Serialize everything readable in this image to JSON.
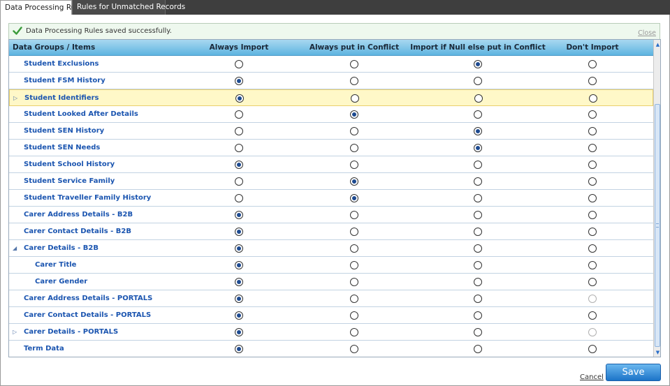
{
  "tabs": [
    {
      "label": "Data Processing Rules",
      "active": true
    },
    {
      "label": "Rules for Unmatched Records",
      "active": false
    }
  ],
  "message": {
    "text": "Data Processing Rules saved successfully.",
    "close_label": "Close"
  },
  "columns": [
    "Data Groups / Items",
    "Always Import",
    "Always put in Conflict",
    "Import if Null else put in Conflict",
    "Don't Import"
  ],
  "rows": [
    {
      "label": "Student Exclusions",
      "indent": 0,
      "expander": "",
      "selected": 2,
      "highlight": false,
      "dim_last": false
    },
    {
      "label": "Student FSM History",
      "indent": 0,
      "expander": "",
      "selected": 0,
      "highlight": false,
      "dim_last": false
    },
    {
      "label": "Student Identifiers",
      "indent": 0,
      "expander": "▷",
      "selected": 0,
      "highlight": true,
      "dim_last": false
    },
    {
      "label": "Student Looked After Details",
      "indent": 0,
      "expander": "",
      "selected": 1,
      "highlight": false,
      "dim_last": false
    },
    {
      "label": "Student SEN History",
      "indent": 0,
      "expander": "",
      "selected": 2,
      "highlight": false,
      "dim_last": false
    },
    {
      "label": "Student SEN Needs",
      "indent": 0,
      "expander": "",
      "selected": 2,
      "highlight": false,
      "dim_last": false
    },
    {
      "label": "Student School History",
      "indent": 0,
      "expander": "",
      "selected": 0,
      "highlight": false,
      "dim_last": false
    },
    {
      "label": "Student Service Family",
      "indent": 0,
      "expander": "",
      "selected": 1,
      "highlight": false,
      "dim_last": false
    },
    {
      "label": "Student Traveller Family History",
      "indent": 0,
      "expander": "",
      "selected": 1,
      "highlight": false,
      "dim_last": false
    },
    {
      "label": "Carer Address Details - B2B",
      "indent": 0,
      "expander": "",
      "selected": 0,
      "highlight": false,
      "dim_last": false
    },
    {
      "label": "Carer Contact Details - B2B",
      "indent": 0,
      "expander": "",
      "selected": 0,
      "highlight": false,
      "dim_last": false
    },
    {
      "label": "Carer Details - B2B",
      "indent": 0,
      "expander": "◢",
      "selected": 0,
      "highlight": false,
      "dim_last": false
    },
    {
      "label": "Carer Title",
      "indent": 1,
      "expander": "",
      "selected": 0,
      "highlight": false,
      "dim_last": false
    },
    {
      "label": "Carer Gender",
      "indent": 1,
      "expander": "",
      "selected": 0,
      "highlight": false,
      "dim_last": false
    },
    {
      "label": "Carer Address Details - PORTALS",
      "indent": 0,
      "expander": "",
      "selected": 0,
      "highlight": false,
      "dim_last": true
    },
    {
      "label": "Carer Contact Details - PORTALS",
      "indent": 0,
      "expander": "",
      "selected": 0,
      "highlight": false,
      "dim_last": false
    },
    {
      "label": "Carer Details - PORTALS",
      "indent": 0,
      "expander": "▷",
      "selected": 0,
      "highlight": false,
      "dim_last": true
    },
    {
      "label": "Term Data",
      "indent": 0,
      "expander": "",
      "selected": 0,
      "highlight": false,
      "dim_last": false
    }
  ],
  "footer": {
    "cancel_label": "Cancel",
    "save_label": "Save"
  },
  "colors": {
    "header_bg": "#5eb4e0",
    "link_blue": "#1b55b0",
    "highlight_row": "#fff8c8",
    "save_button": "#1c74c8"
  }
}
